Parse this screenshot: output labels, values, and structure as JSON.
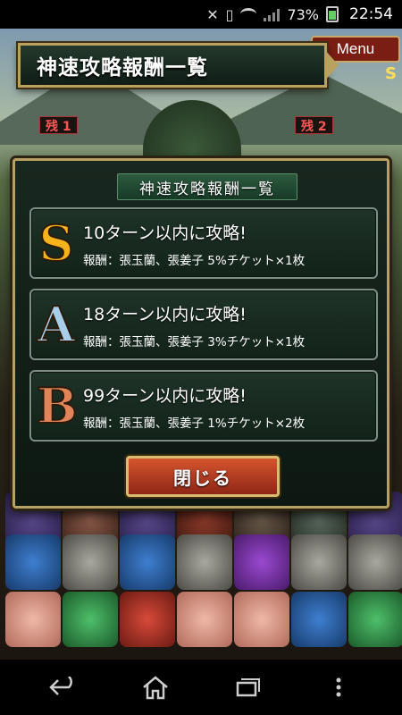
{
  "status_bar": {
    "battery_percent": "73%",
    "time": "22:54"
  },
  "game_hud": {
    "menu_label": "Menu",
    "turn_rank": "S",
    "enemy_left_label": "残 1",
    "enemy_right_label": "残 2"
  },
  "banner": {
    "title": "神速攻略報酬一覧"
  },
  "dialog": {
    "title": "神速攻略報酬一覧",
    "rewards": [
      {
        "rank": "S",
        "condition": "10ターン以内に攻略!",
        "reward": "報酬：張玉蘭、張姜子 5%チケット×1枚",
        "color": "#f6b21b"
      },
      {
        "rank": "A",
        "condition": "18ターン以内に攻略!",
        "reward": "報酬：張玉蘭、張姜子 3%チケット×1枚",
        "color": "#a9cfe8"
      },
      {
        "rank": "B",
        "condition": "99ターン以内に攻略!",
        "reward": "報酬：張玉蘭、張姜子 1%チケット×2枚",
        "color": "#e0845a"
      }
    ],
    "close_label": "閉じる"
  },
  "nav_bar": {
    "back_icon": "back-icon",
    "home_icon": "home-icon",
    "recents_icon": "recents-icon",
    "menu_icon": "overflow-menu-icon"
  }
}
